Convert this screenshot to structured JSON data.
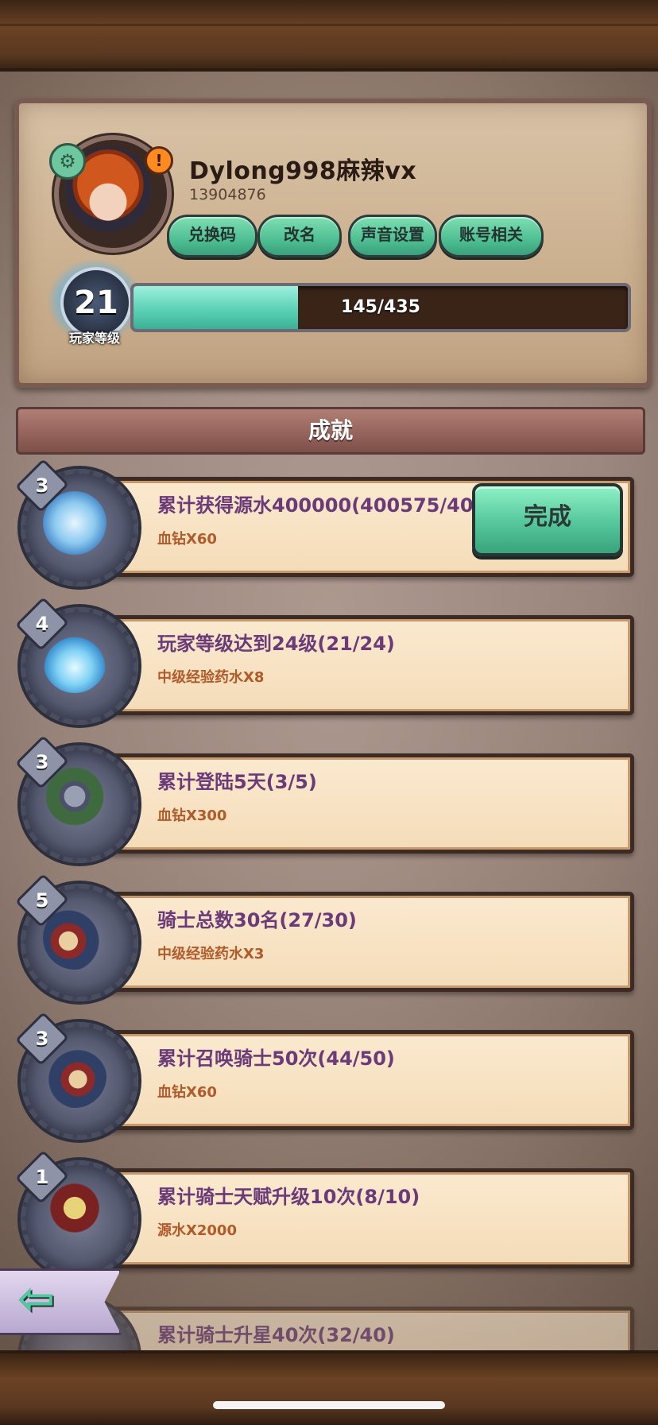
{
  "profile": {
    "name": "Dylong998麻辣vx",
    "id": "13904876",
    "level": "21",
    "level_label": "玩家等级",
    "xp_text": "145/435",
    "xp_progress": 0.333,
    "buttons": [
      "兑换码",
      "改名",
      "声音设置",
      "账号相关"
    ]
  },
  "section_title": "成就",
  "achievements": [
    {
      "count": "3",
      "title": "累计获得源水400000(400575/400000)",
      "reward": "血钻X60",
      "action": "完成",
      "icon": "crystal-ore-icon"
    },
    {
      "count": "4",
      "title": "玩家等级达到24级(21/24)",
      "reward": "中级经验药水X8",
      "icon": "spirit-flame-icon"
    },
    {
      "count": "3",
      "title": "累计登陆5天(3/5)",
      "reward": "血钻X300",
      "icon": "crown-wheel-icon"
    },
    {
      "count": "5",
      "title": "骑士总数30名(27/30)",
      "reward": "中级经验药水X3",
      "icon": "knights-group-icon"
    },
    {
      "count": "3",
      "title": "累计召唤骑士50次(44/50)",
      "reward": "血钻X60",
      "icon": "knights-summon-icon"
    },
    {
      "count": "1",
      "title": "累计骑士天赋升级10次(8/10)",
      "reward": "源水X2000",
      "icon": "knight-talent-icon"
    },
    {
      "title": "累计骑士升星40次(32/40)"
    }
  ],
  "colors": {
    "accent_green": "#55c79b",
    "title_purple": "#6b3a78",
    "reward_orange": "#b15a2a"
  }
}
